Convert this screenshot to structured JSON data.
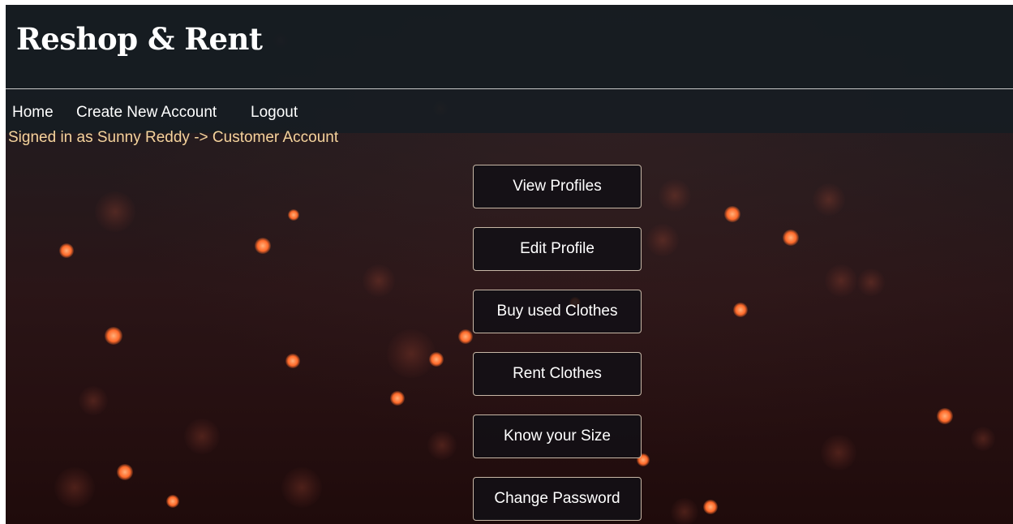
{
  "brand": {
    "title": "Reshop & Rent"
  },
  "nav": {
    "items": [
      {
        "label": "Home"
      },
      {
        "label": "Create New Account"
      },
      {
        "label": "Logout"
      }
    ]
  },
  "status": {
    "text": "Signed in as Sunny Reddy -> Customer Account"
  },
  "menu": {
    "buttons": [
      {
        "label": "View Profiles"
      },
      {
        "label": "Edit Profile"
      },
      {
        "label": "Buy used Clothes"
      },
      {
        "label": "Rent Clothes"
      },
      {
        "label": "Know your Size"
      },
      {
        "label": "Change Password"
      }
    ]
  },
  "colors": {
    "header_bg": "#161c22",
    "status_text": "#f5d39c",
    "button_border": "#c7b7a6",
    "bokeh": "#ff6a2a"
  }
}
